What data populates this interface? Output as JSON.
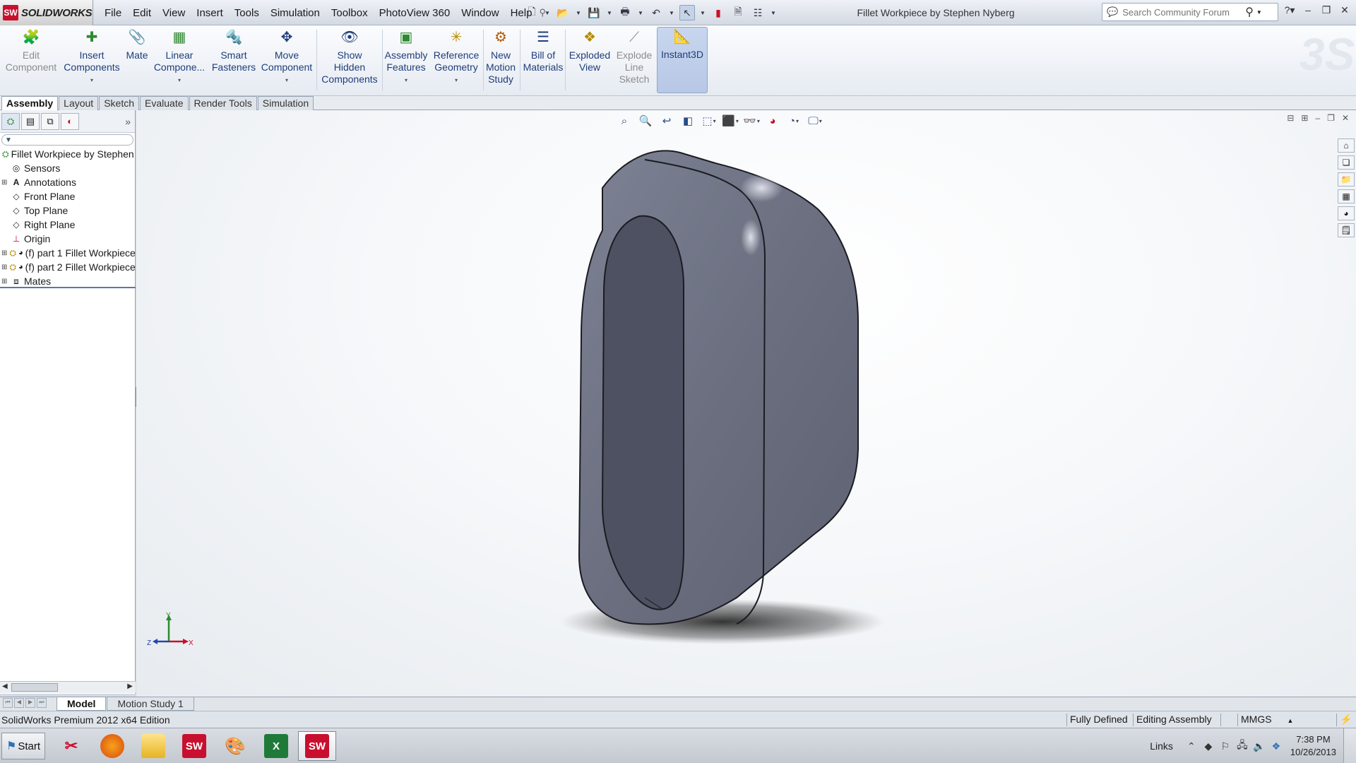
{
  "app": {
    "logo_mark": "SW",
    "logo_text": "SOLIDWORKS",
    "document_title": "Fillet Workpiece by Stephen Nyberg"
  },
  "menu": [
    "File",
    "Edit",
    "View",
    "Insert",
    "Tools",
    "Simulation",
    "Toolbox",
    "PhotoView 360",
    "Window",
    "Help"
  ],
  "search": {
    "placeholder": "Search Community Forum"
  },
  "ribbon": {
    "edit_component": "Edit\nComponent",
    "insert_components": "Insert\nComponents",
    "mate": "Mate",
    "linear_component": "Linear\nCompone...",
    "smart_fasteners": "Smart\nFasteners",
    "move_component": "Move\nComponent",
    "show_hidden": "Show\nHidden\nComponents",
    "assembly_features": "Assembly\nFeatures",
    "reference_geometry": "Reference\nGeometry",
    "new_motion_study": "New\nMotion\nStudy",
    "bill_of_materials": "Bill of\nMaterials",
    "exploded_view": "Exploded\nView",
    "explode_line_sketch": "Explode\nLine\nSketch",
    "instant3d": "Instant3D"
  },
  "command_tabs": [
    "Assembly",
    "Layout",
    "Sketch",
    "Evaluate",
    "Render Tools",
    "Simulation"
  ],
  "tree": {
    "root": "Fillet Workpiece by Stephen Nyberg",
    "items": [
      "Sensors",
      "Annotations",
      "Front Plane",
      "Top Plane",
      "Right Plane",
      "Origin",
      "(f) part 1 Fillet Workpiece",
      "(f) part 2 Fillet Workpiece",
      "Mates"
    ]
  },
  "triad": {
    "x": "X",
    "y": "Y",
    "z": "Z"
  },
  "bottom_tabs": [
    "Model",
    "Motion Study 1"
  ],
  "status": {
    "edition": "SolidWorks Premium 2012 x64 Edition",
    "defined": "Fully Defined",
    "mode": "Editing Assembly",
    "units": "MMGS"
  },
  "taskbar": {
    "start": "Start",
    "links": "Links",
    "time": "7:38 PM",
    "date": "10/26/2013"
  },
  "colors": {
    "model_body": "#6f7383",
    "model_pocket": "#4d5060",
    "accent": "#c8102e"
  }
}
